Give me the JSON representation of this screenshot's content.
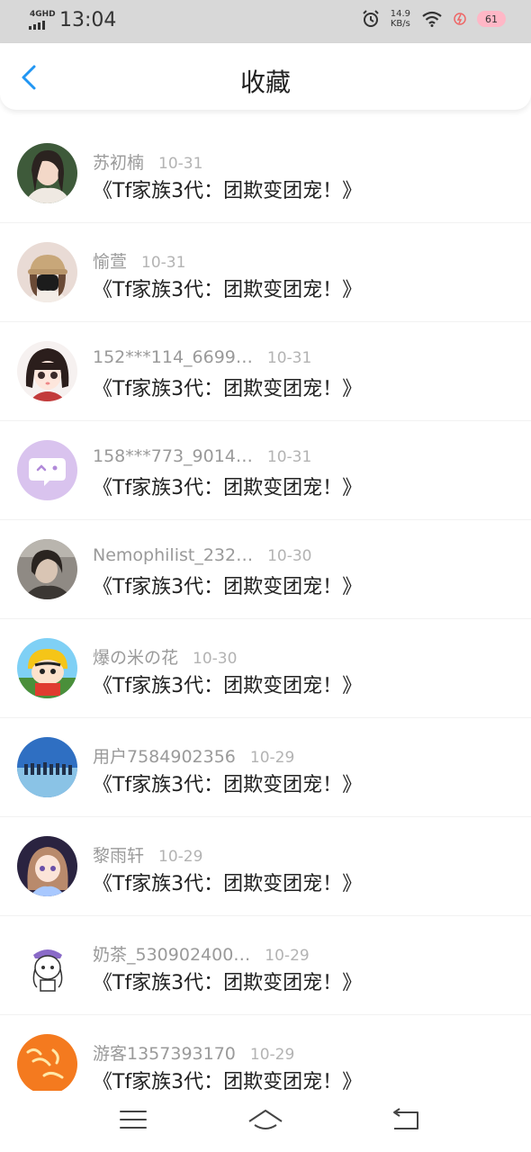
{
  "status_bar": {
    "network": "4GHD",
    "time": "13:04",
    "speed_value": "14.9",
    "speed_unit": "KB/s",
    "battery": "61"
  },
  "header": {
    "title": "收藏"
  },
  "items": [
    {
      "name": "苏初楠",
      "date": "10-31",
      "title": "《Tf家族3代：团欺变团宠！》"
    },
    {
      "name": "愉萱",
      "date": "10-31",
      "title": "《Tf家族3代：团欺变团宠！》"
    },
    {
      "name": "152***114_6699…",
      "date": "10-31",
      "title": "《Tf家族3代：团欺变团宠！》"
    },
    {
      "name": "158***773_9014…",
      "date": "10-31",
      "title": "《Tf家族3代：团欺变团宠！》"
    },
    {
      "name": "Nemophilist_232…",
      "date": "10-30",
      "title": "《Tf家族3代：团欺变团宠！》"
    },
    {
      "name": "爆の米の花",
      "date": "10-30",
      "title": "《Tf家族3代：团欺变团宠！》"
    },
    {
      "name": "用户7584902356",
      "date": "10-29",
      "title": "《Tf家族3代：团欺变团宠！》"
    },
    {
      "name": "黎雨轩",
      "date": "10-29",
      "title": "《Tf家族3代：团欺变团宠！》"
    },
    {
      "name": "奶茶_530902400…",
      "date": "10-29",
      "title": "《Tf家族3代：团欺变团宠！》"
    },
    {
      "name": "游客1357393170",
      "date": "10-29",
      "title": "《Tf家族3代：团欺变团宠！》"
    }
  ],
  "colors": {
    "accent": "#2196f3",
    "status_bar_bg": "#d8d8d8"
  }
}
